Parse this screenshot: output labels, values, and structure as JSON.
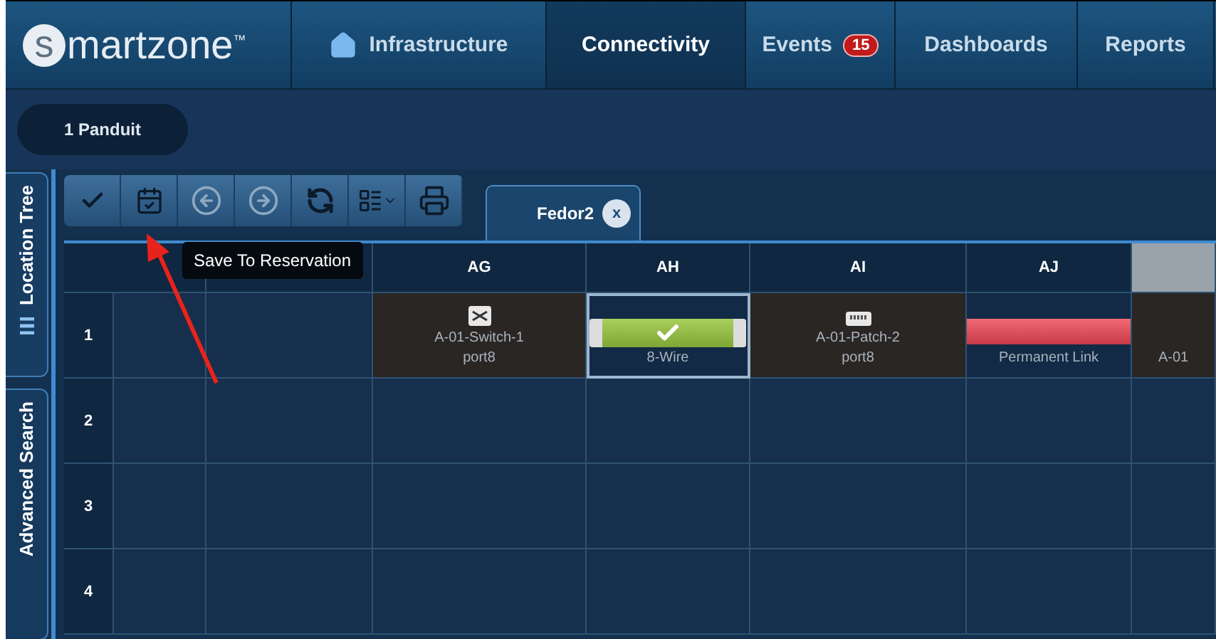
{
  "logo": {
    "initial": "s",
    "rest": "martzone",
    "mark": "™"
  },
  "nav": [
    {
      "label": "Infrastructure",
      "selected": false
    },
    {
      "label": "Connectivity",
      "selected": true
    },
    {
      "label": "Events",
      "badge": "15",
      "selected": false
    },
    {
      "label": "Dashboards",
      "selected": false
    },
    {
      "label": "Reports",
      "selected": false
    }
  ],
  "breadcrumb": "1 Panduit",
  "side_tabs": [
    {
      "label": "Location Tree",
      "selected": true
    },
    {
      "label": "Advanced Search",
      "selected": false
    }
  ],
  "toolbar": [
    {
      "kind": "check",
      "disabled": false
    },
    {
      "kind": "calendar",
      "disabled": false
    },
    {
      "kind": "back",
      "disabled": true
    },
    {
      "kind": "forward",
      "disabled": true
    },
    {
      "kind": "refresh",
      "disabled": false
    },
    {
      "kind": "columns",
      "disabled": false
    },
    {
      "kind": "print",
      "disabled": false
    }
  ],
  "tooltip": "Save To Reservation",
  "document_tab": {
    "label": "Fedor2",
    "close": "x"
  },
  "grid": {
    "columns": [
      {
        "highlighted": false
      },
      {
        "highlighted": false
      },
      {
        "label": "AG",
        "highlighted": false
      },
      {
        "label": "AH",
        "highlighted": false
      },
      {
        "label": "AI",
        "highlighted": false
      },
      {
        "label": "AJ",
        "highlighted": false
      },
      {
        "highlighted": true
      }
    ],
    "rows": [
      {
        "label": "1",
        "cells": [
          {
            "kind": "empty"
          },
          {
            "kind": "empty"
          },
          {
            "kind": "switch",
            "name": "A-01-Switch-1",
            "port": "port8"
          },
          {
            "kind": "cable",
            "name": "8-Wire",
            "selected": true
          },
          {
            "kind": "patch",
            "name": "A-01-Patch-2",
            "port": "port8"
          },
          {
            "kind": "link",
            "name": "Permanent Link"
          },
          {
            "kind": "device",
            "name": "A-01"
          }
        ]
      },
      {
        "label": "2",
        "cells": []
      },
      {
        "label": "3",
        "cells": []
      },
      {
        "label": "4",
        "cells": []
      }
    ]
  }
}
